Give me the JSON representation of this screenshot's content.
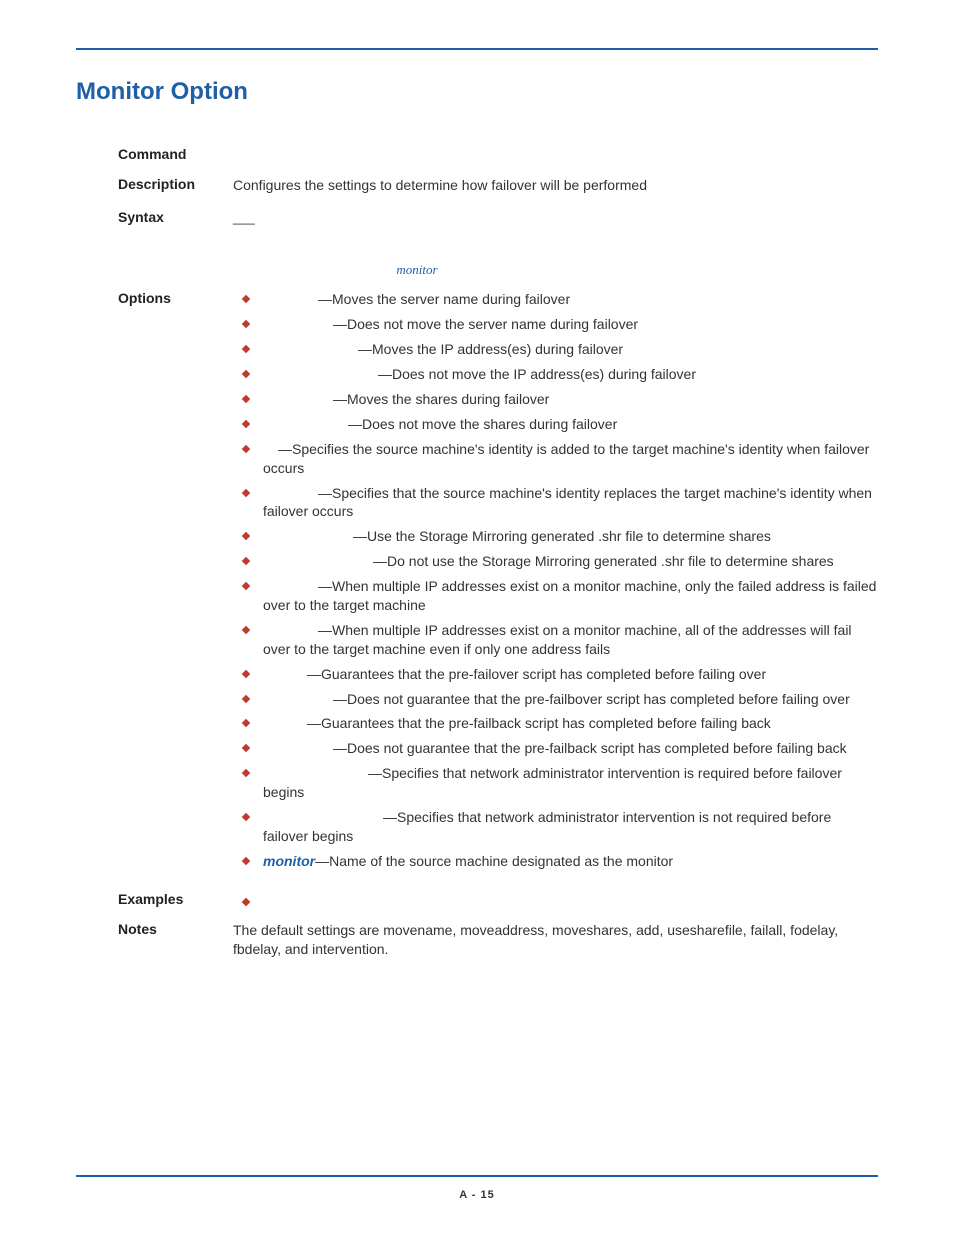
{
  "title": "Monitor Option",
  "labels": {
    "command": "Command",
    "description": "Description",
    "syntax": "Syntax",
    "options": "Options",
    "examples": "Examples",
    "notes": "Notes"
  },
  "description_text": "Configures the settings to determine how failover will be performed",
  "syntax_placeholder": "___",
  "syntax_secondary": "monitor",
  "options": [
    {
      "indent": 55,
      "text": "—Moves the server name during failover"
    },
    {
      "indent": 70,
      "text": "—Does not move the server name during failover"
    },
    {
      "indent": 95,
      "text": "—Moves the IP address(es) during failover"
    },
    {
      "indent": 115,
      "text": "—Does not move the IP address(es) during failover"
    },
    {
      "indent": 70,
      "text": "—Moves the shares during failover"
    },
    {
      "indent": 85,
      "text": "—Does not move the shares during failover"
    },
    {
      "indent": 15,
      "text": "—Specifies the source machine's identity is added to the target machine's identity when failover occurs"
    },
    {
      "indent": 55,
      "text": "—Specifies that the source machine's identity replaces the target machine's identity when failover occurs"
    },
    {
      "indent": 90,
      "text": "—Use the Storage Mirroring generated .shr file to determine shares"
    },
    {
      "indent": 110,
      "text": "—Do not use the Storage Mirroring generated .shr file to determine shares"
    },
    {
      "indent": 55,
      "text": "—When multiple IP addresses exist on a monitor machine, only the failed address is failed over to the target machine"
    },
    {
      "indent": 55,
      "text": "—When multiple IP addresses exist on a monitor machine, all of the addresses will fail over to the target machine even if only one address fails"
    },
    {
      "indent": 44,
      "text": "—Guarantees that the pre-failover script has completed before failing over"
    },
    {
      "indent": 70,
      "text": "—Does not guarantee that the pre-failbover script has completed before failing over"
    },
    {
      "indent": 44,
      "text": "—Guarantees that the pre-failback script has completed before failing back"
    },
    {
      "indent": 70,
      "text": "—Does not guarantee that the pre-failback script has completed before failing back"
    },
    {
      "indent": 105,
      "text": "—Specifies that network administrator intervention is required before failover begins"
    },
    {
      "indent": 120,
      "text": "—Specifies that network administrator intervention is not required before failover begins"
    },
    {
      "indent": 0,
      "prefix": "monitor",
      "text": "—Name of the source machine designated as the monitor"
    }
  ],
  "examples": [
    "",
    ""
  ],
  "notes_text": "The default settings are movename, moveaddress, moveshares, add, usesharefile, failall, fodelay, fbdelay, and intervention.",
  "page_number": "A - 15"
}
